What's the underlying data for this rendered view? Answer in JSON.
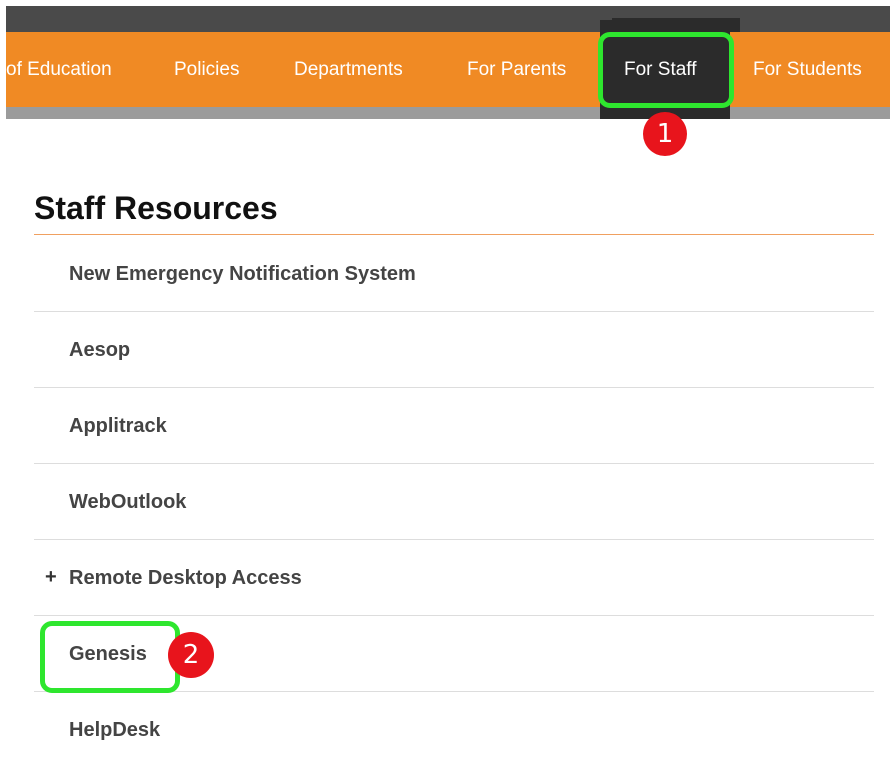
{
  "nav": {
    "items": [
      {
        "label": "of Education"
      },
      {
        "label": "Policies"
      },
      {
        "label": "Departments"
      },
      {
        "label": "For Parents"
      },
      {
        "label": "For Staff",
        "active": true
      },
      {
        "label": "For Students"
      }
    ]
  },
  "annotations": {
    "step1": "1",
    "step2": "2",
    "highlight_color": "#2ee62e",
    "badge_color": "#e8141c"
  },
  "main": {
    "title": "Staff Resources",
    "resources": [
      {
        "label": "New Emergency Notification System"
      },
      {
        "label": "Aesop"
      },
      {
        "label": "Applitrack"
      },
      {
        "label": "WebOutlook"
      },
      {
        "label": "Remote Desktop Access",
        "expander": "+"
      },
      {
        "label": "Genesis"
      },
      {
        "label": "HelpDesk"
      }
    ]
  },
  "colors": {
    "nav_bg": "#f08a24",
    "nav_active_bg": "#2b2b2b",
    "top_strip": "#4a4a4a",
    "title_rule": "#f0a060"
  }
}
